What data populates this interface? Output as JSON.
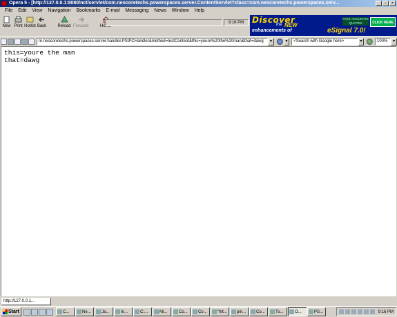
{
  "window": {
    "title": "Opera 5 - [http://127.0.0.1:8080/nct/servlet/com.neocoretechs.powerspaces.server.ContentServlet?class=com.neocoretechs.powerspaces.serv...",
    "minimize": "_",
    "restore": "▫",
    "close": "×"
  },
  "menu": [
    "File",
    "Edit",
    "View",
    "Navigation",
    "Bookmarks",
    "E-mail",
    "Messaging",
    "News",
    "Window",
    "Help"
  ],
  "toolbar": {
    "new": "New",
    "print": "Print",
    "hotlist": "Hotlist",
    "back": "Back",
    "reload": "Reload",
    "forward": "Forward",
    "home": "Home",
    "clock": "9:16 PM"
  },
  "ad": {
    "headline": "Discover",
    "the": "the",
    "new": "NEW",
    "enhancements": "enhancements of",
    "product": "eSignal 7.0!",
    "tagline": "FAST. ACCURATE QUOTES",
    "cta": "CLICK HERE"
  },
  "address": {
    "url": "m.neocoretechs.powerspaces.server.handler.PSIPCHandler&method=testContent&this=youre%20the%20man&that=dawg",
    "search_placeholder": "<Search with Google here>",
    "zoom": "100%"
  },
  "content": {
    "lines": [
      "this=youre the man",
      "that=dawg"
    ]
  },
  "page_tab": {
    "label": "http://127.0.0.1..."
  },
  "taskbar": {
    "start": "Start",
    "tasks": [
      "C...",
      "Ne...",
      "Ja...",
      "In...",
      "C:...",
      "Mi...",
      "Co...",
      "Co...",
      "\"htt...",
      "pin...",
      "Co...",
      "To...",
      "O...",
      "PS..."
    ],
    "time": "9:16 PM"
  }
}
